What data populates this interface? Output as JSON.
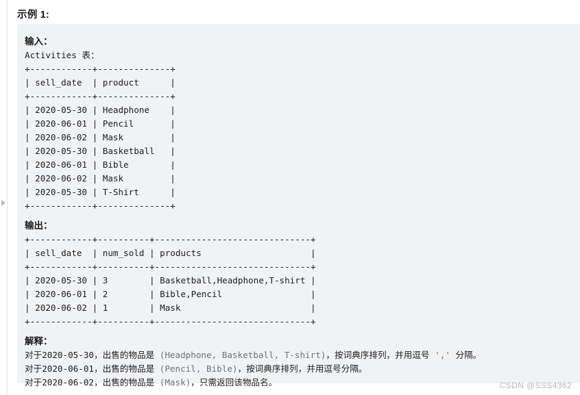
{
  "page": {
    "title": "示例 1:",
    "watermark": "CSDN @SSS4362"
  },
  "block": {
    "input_label": "输入：",
    "input_table_caption": "Activities 表：",
    "output_label": "输出：",
    "explanation_label": "解释：",
    "input_table_lines": [
      "+------------+--------------+",
      "| sell_date  | product      |",
      "+------------+--------------+",
      "| 2020-05-30 | Headphone    |",
      "| 2020-06-01 | Pencil       |",
      "| 2020-06-02 | Mask         |",
      "| 2020-05-30 | Basketball   |",
      "| 2020-06-01 | Bible        |",
      "| 2020-06-02 | Mask         |",
      "| 2020-05-30 | T-Shirt      |",
      "+------------+--------------+"
    ],
    "output_table_lines": [
      "+------------+----------+------------------------------+",
      "| sell_date  | num_sold | products                     |",
      "+------------+----------+------------------------------+",
      "| 2020-05-30 | 3        | Basketball,Headphone,T-shirt |",
      "| 2020-06-01 | 2        | Bible,Pencil                 |",
      "| 2020-06-02 | 1        | Mask                         |",
      "+------------+----------+------------------------------+"
    ],
    "explanation_lines": [
      {
        "pre": "对于2020-05-30，出售的物品是 ",
        "muted": "(Headphone, Basketball, T-shirt)",
        "mid": "，按词典序排列，并用逗号 ",
        "quote": "','",
        "post": " 分隔。"
      },
      {
        "pre": "对于2020-06-01，出售的物品是 ",
        "muted": "(Pencil, Bible)",
        "mid": "，按词典序排列，并用逗号分隔。",
        "quote": "",
        "post": ""
      },
      {
        "pre": "对于2020-06-02，出售的物品是 ",
        "muted": "(Mask)",
        "mid": "，只需返回该物品名。",
        "quote": "",
        "post": ""
      }
    ]
  },
  "tables": {
    "input": {
      "columns": [
        "sell_date",
        "product"
      ],
      "rows": [
        [
          "2020-05-30",
          "Headphone"
        ],
        [
          "2020-06-01",
          "Pencil"
        ],
        [
          "2020-06-02",
          "Mask"
        ],
        [
          "2020-05-30",
          "Basketball"
        ],
        [
          "2020-06-01",
          "Bible"
        ],
        [
          "2020-06-02",
          "Mask"
        ],
        [
          "2020-05-30",
          "T-Shirt"
        ]
      ]
    },
    "output": {
      "columns": [
        "sell_date",
        "num_sold",
        "products"
      ],
      "rows": [
        [
          "2020-05-30",
          "3",
          "Basketball,Headphone,T-shirt"
        ],
        [
          "2020-06-01",
          "2",
          "Bible,Pencil"
        ],
        [
          "2020-06-02",
          "1",
          "Mask"
        ]
      ]
    }
  },
  "colors": {
    "code_background": "#f1f2f4",
    "page_background": "#ffffff",
    "text": "#1c1c1c",
    "muted_text": "#6a737d",
    "quote_text": "#8a6d3b",
    "watermark": "#b7b9bd"
  }
}
